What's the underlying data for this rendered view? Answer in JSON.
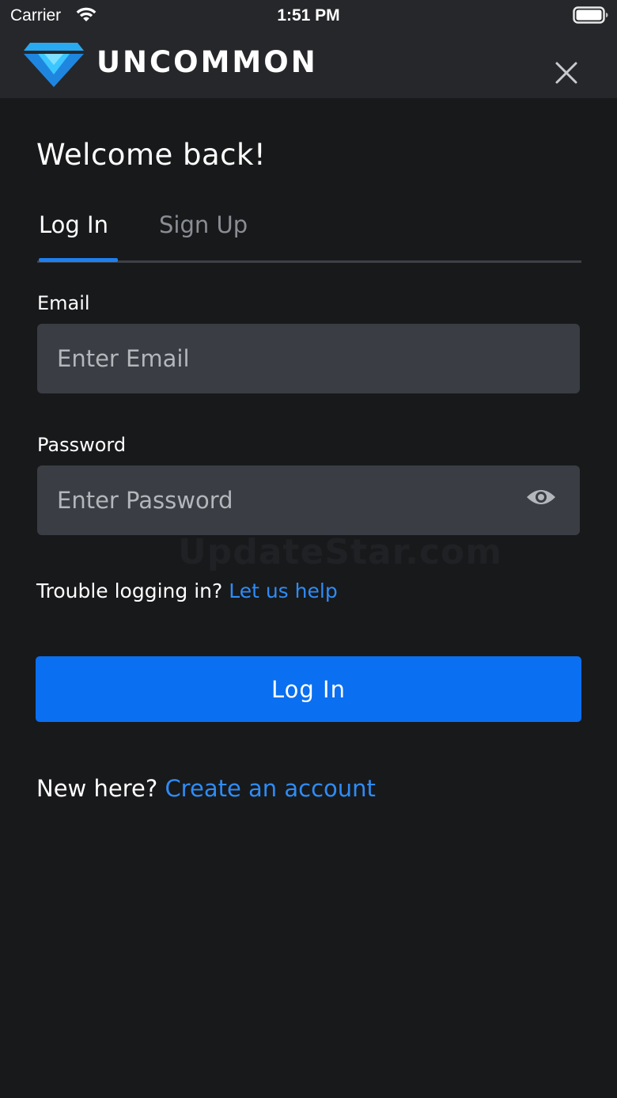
{
  "status_bar": {
    "carrier": "Carrier",
    "time": "1:51 PM"
  },
  "header": {
    "logo_text": "UNCOMMON",
    "close_icon": "close-icon",
    "logo_icon": "diamond-logo-icon"
  },
  "welcome_title": "Welcome back!",
  "tabs": [
    {
      "label": "Log In",
      "active": true
    },
    {
      "label": "Sign Up",
      "active": false
    }
  ],
  "form": {
    "email": {
      "label": "Email",
      "placeholder": "Enter Email",
      "value": ""
    },
    "password": {
      "label": "Password",
      "placeholder": "Enter Password",
      "value": "",
      "toggle_icon": "eye-icon"
    }
  },
  "help": {
    "text": "Trouble logging in?",
    "link": "Let us help"
  },
  "login_button": "Log In",
  "signup_prompt": {
    "text": "New here?",
    "link": "Create an account"
  },
  "watermark": "UpdateStar.com",
  "colors": {
    "background": "#18191b",
    "header": "#26272a",
    "input": "#3a3d43",
    "accent": "#0a6ff0",
    "link": "#2e8cf6",
    "logo_blue": "#29a9f0"
  }
}
